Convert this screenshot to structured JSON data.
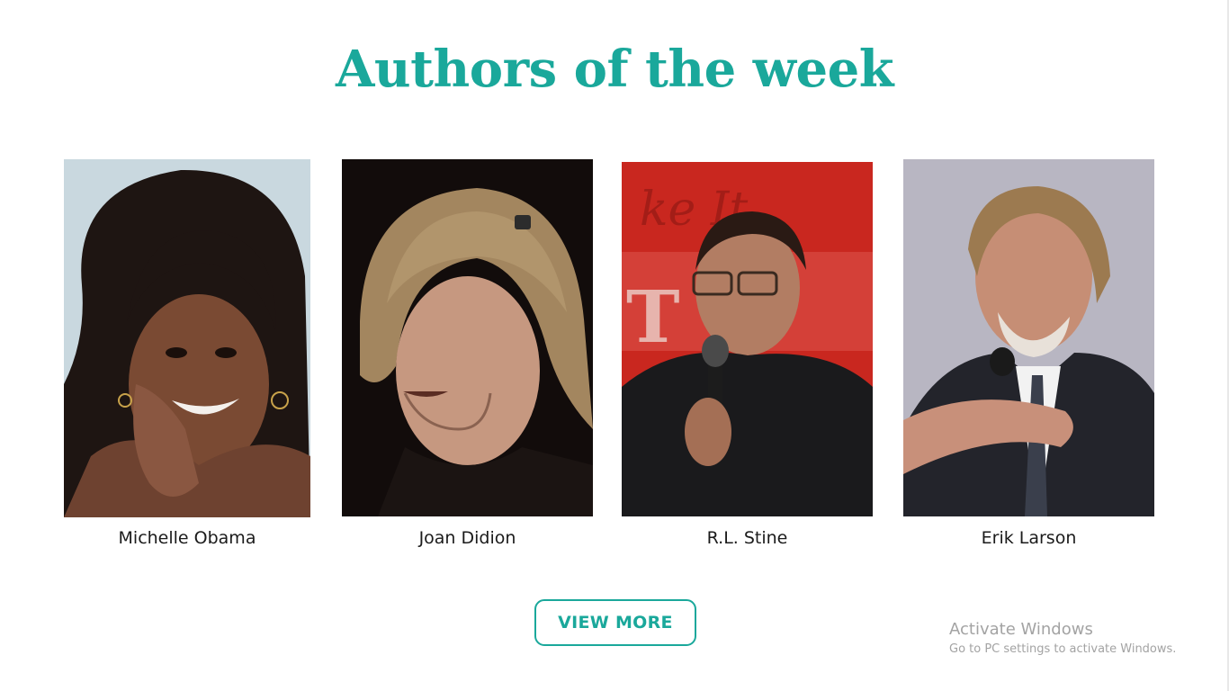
{
  "section": {
    "title": "Authors of the week",
    "accent_color": "#1aa89b"
  },
  "authors": [
    {
      "name": "Michelle Obama"
    },
    {
      "name": "Joan Didion"
    },
    {
      "name": "R.L. Stine"
    },
    {
      "name": "Erik Larson"
    }
  ],
  "actions": {
    "view_more_label": "VIEW MORE"
  },
  "os_watermark": {
    "title": "Activate Windows",
    "subtitle": "Go to PC settings to activate Windows."
  }
}
